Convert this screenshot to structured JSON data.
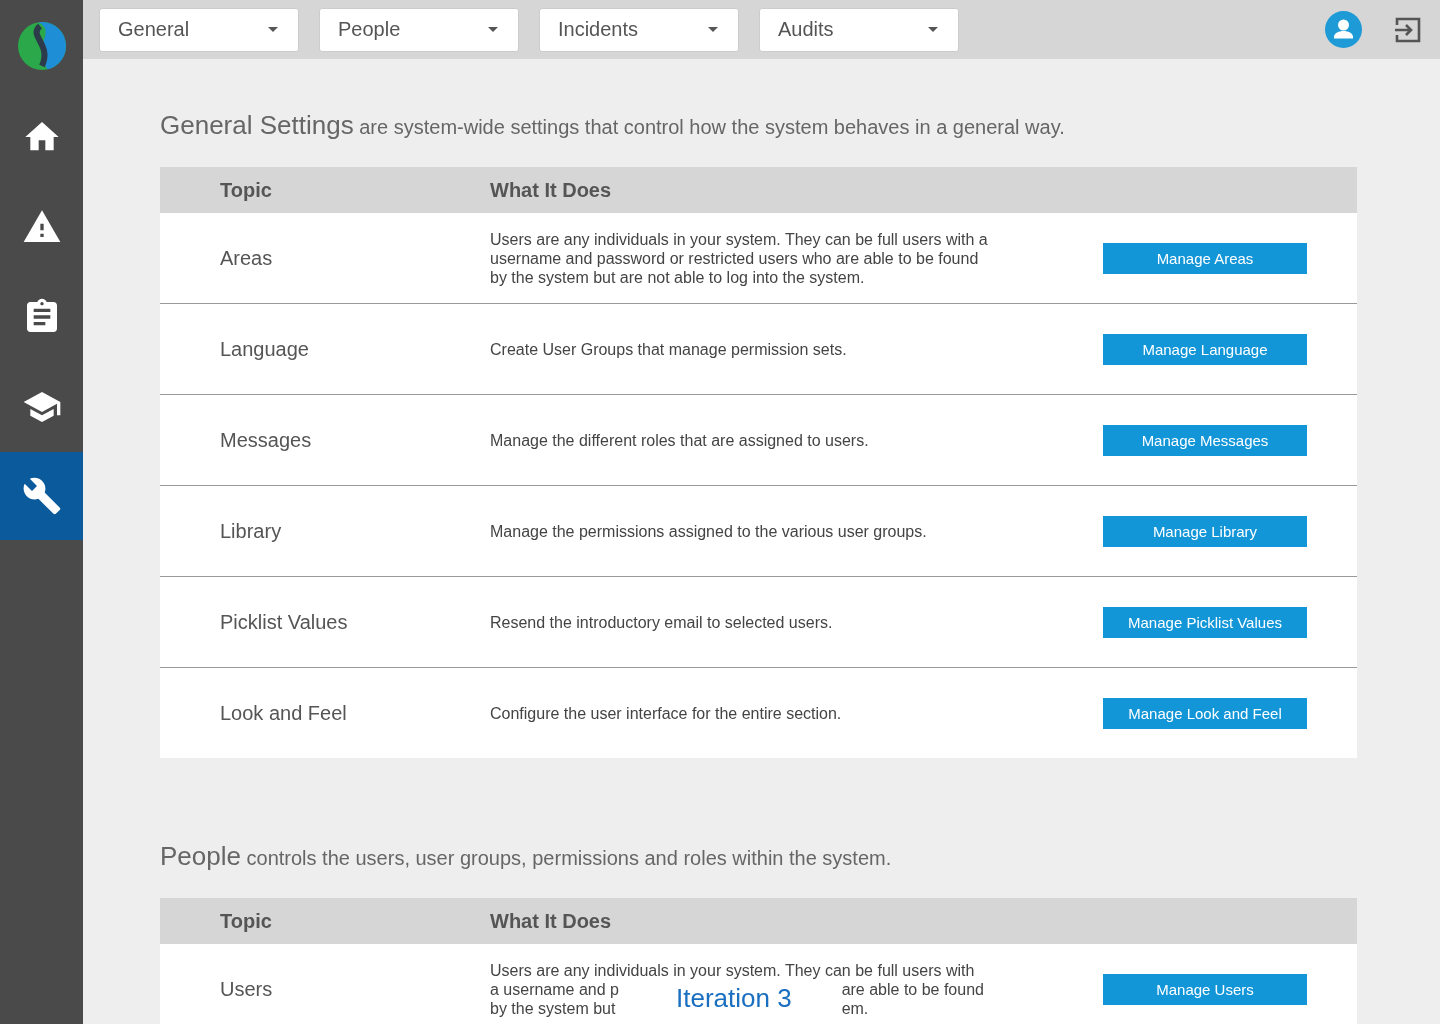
{
  "sidebar": {
    "items": [
      {
        "kind": "home",
        "selected": false
      },
      {
        "kind": "warning",
        "selected": false
      },
      {
        "kind": "clipboard",
        "selected": false
      },
      {
        "kind": "school",
        "selected": false
      },
      {
        "kind": "wrench",
        "selected": true
      }
    ]
  },
  "topbar": {
    "dropdowns": [
      "General",
      "People",
      "Incidents",
      "Audits"
    ]
  },
  "sections": [
    {
      "title": "General Settings",
      "subtitle": "are system-wide settings that control how the system behaves in a general way.",
      "columns": [
        "Topic",
        "What It Does"
      ],
      "rows": [
        {
          "topic": "Areas",
          "description": "Users are any individuals in your system. They can be full users with a username and password or restricted users who are able to be found by the system but are not able to log into the system.",
          "button": "Manage Areas"
        },
        {
          "topic": "Language",
          "description": "Create User Groups that manage permission sets.",
          "button": "Manage Language"
        },
        {
          "topic": "Messages",
          "description": "Manage the different roles that are assigned to users.",
          "button": "Manage Messages"
        },
        {
          "topic": "Library",
          "description": "Manage the permissions assigned to the various user groups.",
          "button": "Manage Library"
        },
        {
          "topic": "Picklist Values",
          "description": "Resend the introductory email to selected users.",
          "button": "Manage Picklist Values"
        },
        {
          "topic": "Look and Feel",
          "description": "Configure the user interface for the entire section.",
          "button": "Manage Look and Feel"
        }
      ]
    },
    {
      "title": "People",
      "subtitle": "controls the users, user groups, permissions and roles within the system.",
      "columns": [
        "Topic",
        "What It Does"
      ],
      "rows": [
        {
          "topic": "Users",
          "description": "Users are any individuals in your system. They can be full users with",
          "covered_lines": [
            {
              "left": "a username and p",
              "right": "are able to be found"
            },
            {
              "left": "by the system but",
              "right": "em."
            }
          ],
          "overlay": "Iteration 3",
          "button": "Manage Users"
        }
      ]
    }
  ]
}
